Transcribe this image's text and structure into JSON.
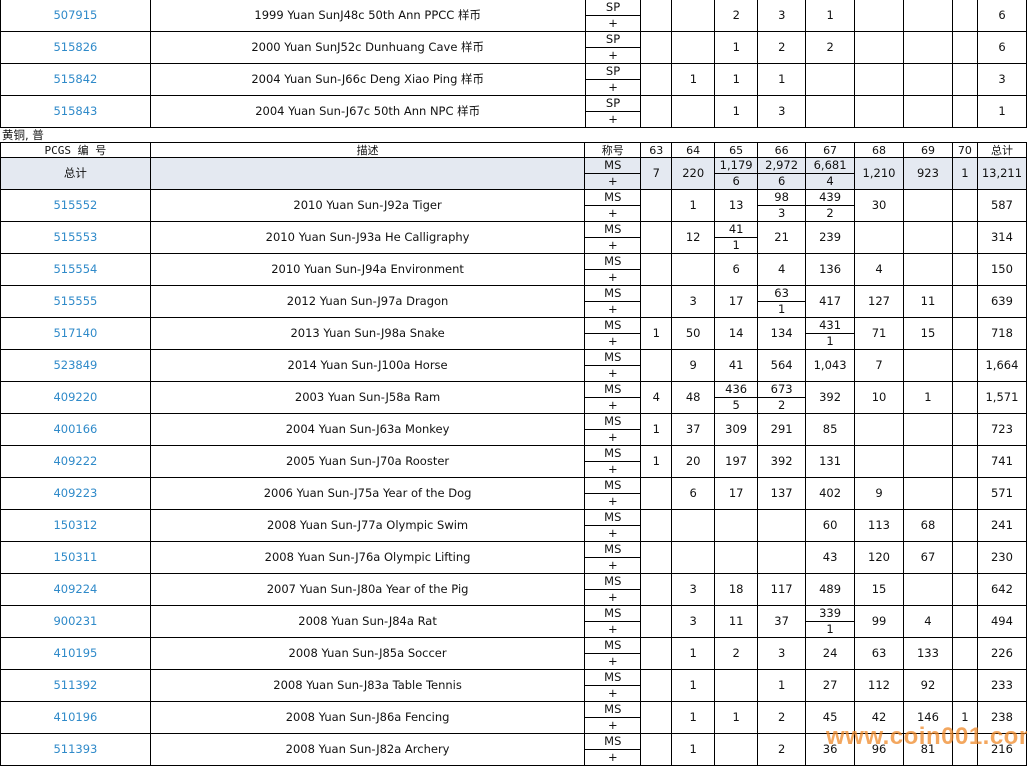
{
  "top_rows": [
    {
      "id": "507915",
      "desc": "1999 Yuan SunJ48c 50th Ann PPCC 样币",
      "grade": "SP",
      "plus": "+",
      "g63": "",
      "g64": "",
      "g65": "2",
      "g66": "3",
      "g67": "1",
      "g68": "",
      "g69": "",
      "g70": "",
      "total": "6"
    },
    {
      "id": "515826",
      "desc": "2000 Yuan SunJ52c Dunhuang Cave 样币",
      "grade": "SP",
      "plus": "+",
      "g63": "",
      "g64": "",
      "g65": "1",
      "g66": "2",
      "g67": "2",
      "g68": "",
      "g69": "",
      "g70": "",
      "total": "6"
    },
    {
      "id": "515842",
      "desc": "2004 Yuan Sun-J66c Deng Xiao Ping 样币",
      "grade": "SP",
      "plus": "+",
      "g63": "",
      "g64": "1",
      "g65": "1",
      "g66": "1",
      "g67": "",
      "g68": "",
      "g69": "",
      "g70": "",
      "total": "3"
    },
    {
      "id": "515843",
      "desc": "2004 Yuan Sun-J67c 50th Ann NPC 样币",
      "grade": "SP",
      "plus": "+",
      "g63": "",
      "g64": "",
      "g65": "1",
      "g66": "3",
      "g67": "",
      "g68": "",
      "g69": "",
      "g70": "",
      "total": "1"
    }
  ],
  "section_label": "黄铜, 普",
  "header": {
    "pcgs": "PCGS 编 号",
    "desc": "描述",
    "grade": "称号",
    "c63": "63",
    "c64": "64",
    "c65": "65",
    "c66": "66",
    "c67": "67",
    "c68": "68",
    "c69": "69",
    "c70": "70",
    "total": "总计"
  },
  "totals_row": {
    "label": "总计",
    "grade": "MS",
    "plus": "+",
    "g63": "7",
    "g64": "220",
    "g65": "1,179",
    "g65p": "6",
    "g66": "2,972",
    "g66p": "6",
    "g67": "6,681",
    "g67p": "4",
    "g68": "1,210",
    "g69": "923",
    "g70": "1",
    "total": "13,211"
  },
  "rows": [
    {
      "id": "515552",
      "desc": "2010 Yuan Sun-J92a Tiger",
      "grade": "MS",
      "plus": "+",
      "g63": "",
      "g64": "1",
      "g65": "13",
      "g66": "98",
      "g66p": "3",
      "g67": "439",
      "g67p": "2",
      "g68": "30",
      "g69": "",
      "g70": "",
      "total": "587"
    },
    {
      "id": "515553",
      "desc": "2010 Yuan Sun-J93a He Calligraphy",
      "grade": "MS",
      "plus": "+",
      "g63": "",
      "g64": "12",
      "g65": "41",
      "g65p": "1",
      "g66": "21",
      "g67": "239",
      "g68": "",
      "g69": "",
      "g70": "",
      "total": "314"
    },
    {
      "id": "515554",
      "desc": "2010 Yuan Sun-J94a Environment",
      "grade": "MS",
      "plus": "+",
      "g63": "",
      "g64": "",
      "g65": "6",
      "g66": "4",
      "g67": "136",
      "g68": "4",
      "g69": "",
      "g70": "",
      "total": "150"
    },
    {
      "id": "515555",
      "desc": "2012 Yuan Sun-J97a Dragon",
      "grade": "MS",
      "plus": "+",
      "g63": "",
      "g64": "3",
      "g65": "17",
      "g66": "63",
      "g66p": "1",
      "g67": "417",
      "g68": "127",
      "g69": "11",
      "g70": "",
      "total": "639"
    },
    {
      "id": "517140",
      "desc": "2013 Yuan Sun-J98a Snake",
      "grade": "MS",
      "plus": "+",
      "g63": "1",
      "g64": "50",
      "g65": "14",
      "g66": "134",
      "g67": "431",
      "g67p": "1",
      "g68": "71",
      "g69": "15",
      "g70": "",
      "total": "718"
    },
    {
      "id": "523849",
      "desc": "2014 Yuan Sun-J100a Horse",
      "grade": "MS",
      "plus": "+",
      "g63": "",
      "g64": "9",
      "g65": "41",
      "g66": "564",
      "g67": "1,043",
      "g68": "7",
      "g69": "",
      "g70": "",
      "total": "1,664"
    },
    {
      "id": "409220",
      "desc": "2003 Yuan Sun-J58a Ram",
      "grade": "MS",
      "plus": "+",
      "g63": "4",
      "g64": "48",
      "g65": "436",
      "g65p": "5",
      "g66": "673",
      "g66p": "2",
      "g67": "392",
      "g68": "10",
      "g69": "1",
      "g70": "",
      "total": "1,571"
    },
    {
      "id": "400166",
      "desc": "2004 Yuan Sun-J63a Monkey",
      "grade": "MS",
      "plus": "+",
      "g63": "1",
      "g64": "37",
      "g65": "309",
      "g66": "291",
      "g67": "85",
      "g68": "",
      "g69": "",
      "g70": "",
      "total": "723"
    },
    {
      "id": "409222",
      "desc": "2005 Yuan Sun-J70a Rooster",
      "grade": "MS",
      "plus": "+",
      "g63": "1",
      "g64": "20",
      "g65": "197",
      "g66": "392",
      "g67": "131",
      "g68": "",
      "g69": "",
      "g70": "",
      "total": "741"
    },
    {
      "id": "409223",
      "desc": "2006 Yuan Sun-J75a Year of the Dog",
      "grade": "MS",
      "plus": "+",
      "g63": "",
      "g64": "6",
      "g65": "17",
      "g66": "137",
      "g67": "402",
      "g68": "9",
      "g69": "",
      "g70": "",
      "total": "571"
    },
    {
      "id": "150312",
      "desc": "2008 Yuan Sun-J77a Olympic Swim",
      "grade": "MS",
      "plus": "+",
      "g63": "",
      "g64": "",
      "g65": "",
      "g66": "",
      "g67": "60",
      "g68": "113",
      "g69": "68",
      "g70": "",
      "total": "241"
    },
    {
      "id": "150311",
      "desc": "2008 Yuan Sun-J76a Olympic Lifting",
      "grade": "MS",
      "plus": "+",
      "g63": "",
      "g64": "",
      "g65": "",
      "g66": "",
      "g67": "43",
      "g68": "120",
      "g69": "67",
      "g70": "",
      "total": "230"
    },
    {
      "id": "409224",
      "desc": "2007 Yuan Sun-J80a Year of the Pig",
      "grade": "MS",
      "plus": "+",
      "g63": "",
      "g64": "3",
      "g65": "18",
      "g66": "117",
      "g67": "489",
      "g68": "15",
      "g69": "",
      "g70": "",
      "total": "642"
    },
    {
      "id": "900231",
      "desc": "2008 Yuan Sun-J84a Rat",
      "grade": "MS",
      "plus": "+",
      "g63": "",
      "g64": "3",
      "g65": "11",
      "g66": "37",
      "g67": "339",
      "g67p": "1",
      "g68": "99",
      "g69": "4",
      "g70": "",
      "total": "494"
    },
    {
      "id": "410195",
      "desc": "2008 Yuan Sun-J85a Soccer",
      "grade": "MS",
      "plus": "+",
      "g63": "",
      "g64": "1",
      "g65": "2",
      "g66": "3",
      "g67": "24",
      "g68": "63",
      "g69": "133",
      "g70": "",
      "total": "226"
    },
    {
      "id": "511392",
      "desc": "2008 Yuan Sun-J83a Table Tennis",
      "grade": "MS",
      "plus": "+",
      "g63": "",
      "g64": "1",
      "g65": "",
      "g66": "1",
      "g67": "27",
      "g68": "112",
      "g69": "92",
      "g70": "",
      "total": "233"
    },
    {
      "id": "410196",
      "desc": "2008 Yuan Sun-J86a Fencing",
      "grade": "MS",
      "plus": "+",
      "g63": "",
      "g64": "1",
      "g65": "1",
      "g66": "2",
      "g67": "45",
      "g68": "42",
      "g69": "146",
      "g70": "1",
      "total": "238"
    },
    {
      "id": "511393",
      "desc": "2008 Yuan Sun-J82a Archery",
      "grade": "MS",
      "plus": "+",
      "g63": "",
      "g64": "1",
      "g65": "",
      "g66": "2",
      "g67": "36",
      "g68": "96",
      "g69": "81",
      "g70": "",
      "total": "216"
    }
  ],
  "watermark": "www.coin001.com",
  "colors": {
    "link": "#2f8ac9",
    "total_row_bg": "#e4e9f1",
    "watermark": "#f08a2a"
  }
}
